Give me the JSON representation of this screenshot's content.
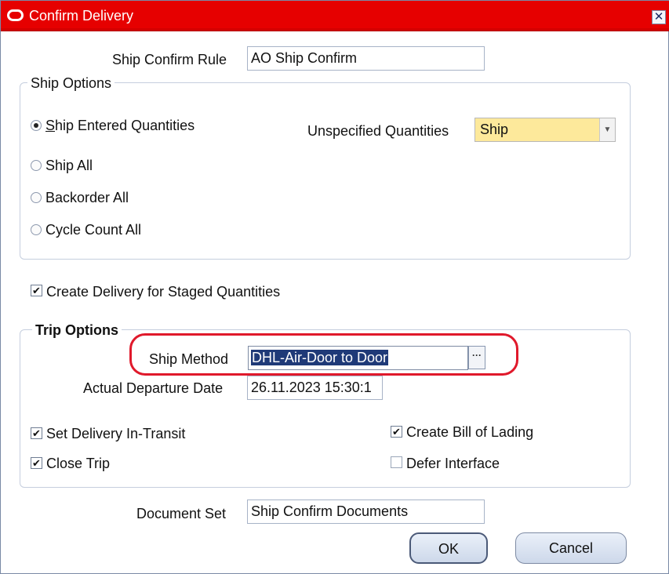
{
  "window": {
    "title": "Confirm Delivery",
    "close_glyph": "✕"
  },
  "ship_confirm_rule": {
    "label": "Ship Confirm Rule",
    "value": "AO Ship Confirm"
  },
  "ship_options": {
    "title": "Ship Options",
    "radios": [
      {
        "label": "Ship Entered Quantities",
        "selected": true
      },
      {
        "label": "Ship All",
        "selected": false
      },
      {
        "label": "Backorder All",
        "selected": false
      },
      {
        "label": "Cycle Count All",
        "selected": false
      }
    ],
    "unspecified_quantities": {
      "label": "Unspecified Quantities",
      "value": "Ship"
    }
  },
  "create_delivery_staged": {
    "label": "Create Delivery for Staged Quantities",
    "checked": true
  },
  "trip_options": {
    "title": "Trip Options",
    "ship_method": {
      "label": "Ship Method",
      "value": "DHL-Air-Door to Door",
      "lov_glyph": "···"
    },
    "actual_departure_date": {
      "label": "Actual Departure Date",
      "value": "26.11.2023 15:30:1"
    },
    "checkboxes": {
      "set_in_transit": {
        "label": "Set Delivery In-Transit",
        "checked": true
      },
      "close_trip": {
        "label": "Close Trip",
        "checked": true
      },
      "create_bol": {
        "label": "Create Bill of Lading",
        "checked": true
      },
      "defer_interface": {
        "label": "Defer Interface",
        "checked": false
      }
    }
  },
  "document_set": {
    "label": "Document Set",
    "value": "Ship Confirm Documents"
  },
  "buttons": {
    "ok": "OK",
    "cancel": "Cancel"
  },
  "icons": {
    "app": "oracle-icon",
    "dropdown": "chevron-down-icon",
    "check": "checkmark-icon"
  },
  "colors": {
    "titlebar": "#e60000",
    "required_field": "#fde99b",
    "highlight_oval": "#e0192b"
  }
}
